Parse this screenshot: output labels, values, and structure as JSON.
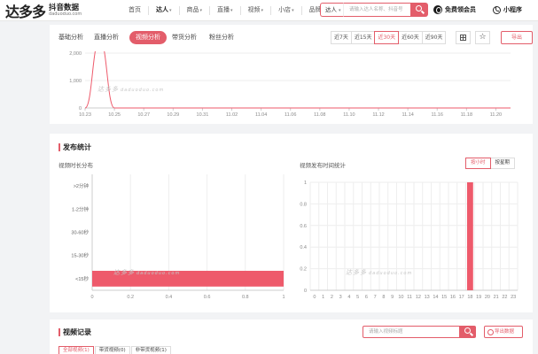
{
  "brand": {
    "name": "达多多",
    "sub": "抖音数据",
    "url": "daduoduo.com"
  },
  "nav": [
    {
      "label": "首页",
      "caret": false,
      "active": false
    },
    {
      "label": "达人",
      "caret": true,
      "active": true
    },
    {
      "label": "商品",
      "caret": true,
      "active": false
    },
    {
      "label": "直播",
      "caret": true,
      "active": false
    },
    {
      "label": "视频",
      "caret": true,
      "active": false
    },
    {
      "label": "小店",
      "caret": true,
      "active": false
    },
    {
      "label": "品牌",
      "caret": true,
      "active": false
    }
  ],
  "search": {
    "scope": "达人",
    "placeholder": "请输入达人名称、抖音号"
  },
  "header_links": {
    "vip": "免费领会员",
    "mini": "小程序"
  },
  "tabs": [
    {
      "label": "基础分析",
      "active": false
    },
    {
      "label": "直播分析",
      "active": false
    },
    {
      "label": "视频分析",
      "active": true
    },
    {
      "label": "带货分析",
      "active": false
    },
    {
      "label": "粉丝分析",
      "active": false
    }
  ],
  "date_ranges": [
    {
      "label": "近7天",
      "active": false
    },
    {
      "label": "近15天",
      "active": false
    },
    {
      "label": "近30天",
      "active": true
    },
    {
      "label": "近60天",
      "active": false
    },
    {
      "label": "近90天",
      "active": false
    }
  ],
  "export_label": "导出",
  "watermark": {
    "brand": "达多多",
    "url": "daduoduo.com"
  },
  "trend_chart": {
    "y_ticks": [
      "2,000",
      "1,000",
      "0"
    ],
    "x_labels": [
      "10.23",
      "10.25",
      "10.27",
      "10.29",
      "10.31",
      "11.02",
      "11.04",
      "11.06",
      "11.08",
      "11.10",
      "11.12",
      "11.14",
      "11.16",
      "11.18",
      "11.20"
    ]
  },
  "publish": {
    "title": "发布统计",
    "duration": {
      "title": "视频时长分布",
      "categories": [
        ">2分钟",
        "1-2分钟",
        "30-60秒",
        "15-30秒",
        "<15秒"
      ],
      "x_ticks": [
        "0",
        "0.2",
        "0.4",
        "0.6",
        "0.8",
        "1"
      ]
    },
    "time": {
      "title": "视频发布时间统计",
      "toggles": [
        {
          "label": "按小时",
          "active": true
        },
        {
          "label": "按星期",
          "active": false
        }
      ],
      "y_ticks": [
        "1",
        "0.8",
        "0.6",
        "0.4",
        "0.2",
        "0"
      ],
      "x_ticks": [
        "0",
        "1",
        "2",
        "3",
        "4",
        "5",
        "6",
        "7",
        "8",
        "9",
        "10",
        "11",
        "12",
        "13",
        "14",
        "15",
        "16",
        "17",
        "18",
        "19",
        "20",
        "21",
        "22",
        "23"
      ]
    }
  },
  "records": {
    "title": "视频记录",
    "search_placeholder": "请输入视频标题",
    "export": "导出数据",
    "tabs": [
      {
        "label": "全部视频(1)",
        "active": true
      },
      {
        "label": "带货视频(0)",
        "active": false
      },
      {
        "label": "非带货视频(1)",
        "active": false
      }
    ]
  },
  "colors": {
    "accent": "#e35d6a",
    "bar": "#ee5a6b"
  },
  "chart_data": [
    {
      "type": "line",
      "title": "",
      "x": [
        "10.23",
        "10.24",
        "10.25",
        "10.26",
        "10.27",
        "10.28",
        "10.29",
        "10.30",
        "10.31",
        "11.01",
        "11.02",
        "11.03",
        "11.04",
        "11.05",
        "11.06",
        "11.07",
        "11.08",
        "11.09",
        "11.10",
        "11.11",
        "11.12",
        "11.13",
        "11.14",
        "11.15",
        "11.16",
        "11.17",
        "11.18",
        "11.19",
        "11.20",
        "11.21"
      ],
      "series": [
        {
          "values": [
            0,
            2500,
            0,
            0,
            0,
            0,
            0,
            0,
            0,
            0,
            0,
            0,
            0,
            0,
            0,
            0,
            0,
            0,
            0,
            0,
            0,
            0,
            0,
            0,
            0,
            0,
            0,
            0,
            0,
            0
          ]
        }
      ],
      "ylim": [
        0,
        2000
      ],
      "color": "#ee5a6b"
    },
    {
      "type": "bar",
      "orientation": "horizontal",
      "title": "视频时长分布",
      "categories": [
        ">2分钟",
        "1-2分钟",
        "30-60秒",
        "15-30秒",
        "<15秒"
      ],
      "values": [
        0,
        0,
        0,
        0,
        1
      ],
      "xlim": [
        0,
        1
      ],
      "color": "#ee5a6b"
    },
    {
      "type": "bar",
      "title": "视频发布时间统计",
      "categories": [
        "0",
        "1",
        "2",
        "3",
        "4",
        "5",
        "6",
        "7",
        "8",
        "9",
        "10",
        "11",
        "12",
        "13",
        "14",
        "15",
        "16",
        "17",
        "18",
        "19",
        "20",
        "21",
        "22",
        "23"
      ],
      "values": [
        0,
        0,
        0,
        0,
        0,
        0,
        0,
        0,
        0,
        0,
        0,
        0,
        0,
        0,
        0,
        0,
        0,
        0,
        1,
        0,
        0,
        0,
        0,
        0
      ],
      "ylim": [
        0,
        1
      ],
      "color": "#ee5a6b"
    }
  ]
}
